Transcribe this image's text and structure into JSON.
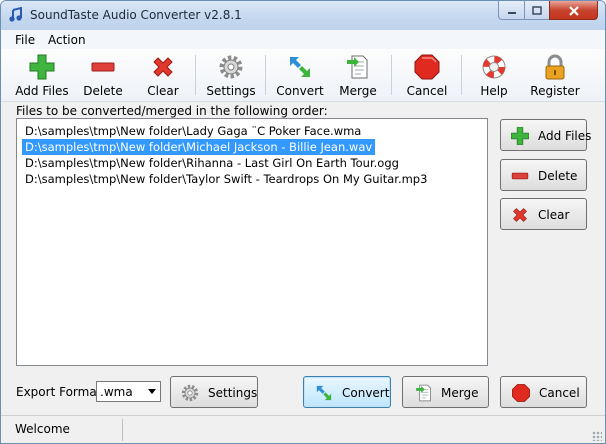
{
  "window": {
    "title": "SoundTaste Audio Converter v2.8.1"
  },
  "menu": [
    "File",
    "Action"
  ],
  "toolbar": {
    "add_files": "Add Files",
    "delete": "Delete",
    "clear": "Clear",
    "settings": "Settings",
    "convert": "Convert",
    "merge": "Merge",
    "cancel": "Cancel",
    "help": "Help",
    "register": "Register"
  },
  "list": {
    "label": "Files to be converted/merged in the following order:",
    "files": [
      "D:\\samples\\tmp\\New folder\\Lady Gaga ¨C Poker Face.wma",
      "D:\\samples\\tmp\\New folder\\Michael Jackson - Billie Jean.wav",
      "D:\\samples\\tmp\\New folder\\Rihanna - Last Girl On Earth Tour.ogg",
      "D:\\samples\\tmp\\New folder\\Taylor Swift - Teardrops On My Guitar.mp3"
    ],
    "selected_index": 1
  },
  "side_buttons": {
    "add_files": "Add Files",
    "delete": "Delete",
    "clear": "Clear"
  },
  "bottom": {
    "export_label": "Export Format:",
    "format_value": ".wma",
    "settings": "Settings",
    "convert": "Convert",
    "merge": "Merge",
    "cancel": "Cancel"
  },
  "status": {
    "text": "Welcome"
  },
  "colors": {
    "selection": "#3399ff",
    "title_gradient": "#c4d7ef",
    "close_red": "#c7452f"
  },
  "icons": {
    "add": "plus-icon",
    "delete": "minus-icon",
    "clear": "x-icon",
    "settings": "gear-icon",
    "convert": "arrows-icon",
    "merge": "document-icon",
    "cancel": "stop-icon",
    "help": "lifebuoy-icon",
    "register": "lock-icon"
  }
}
